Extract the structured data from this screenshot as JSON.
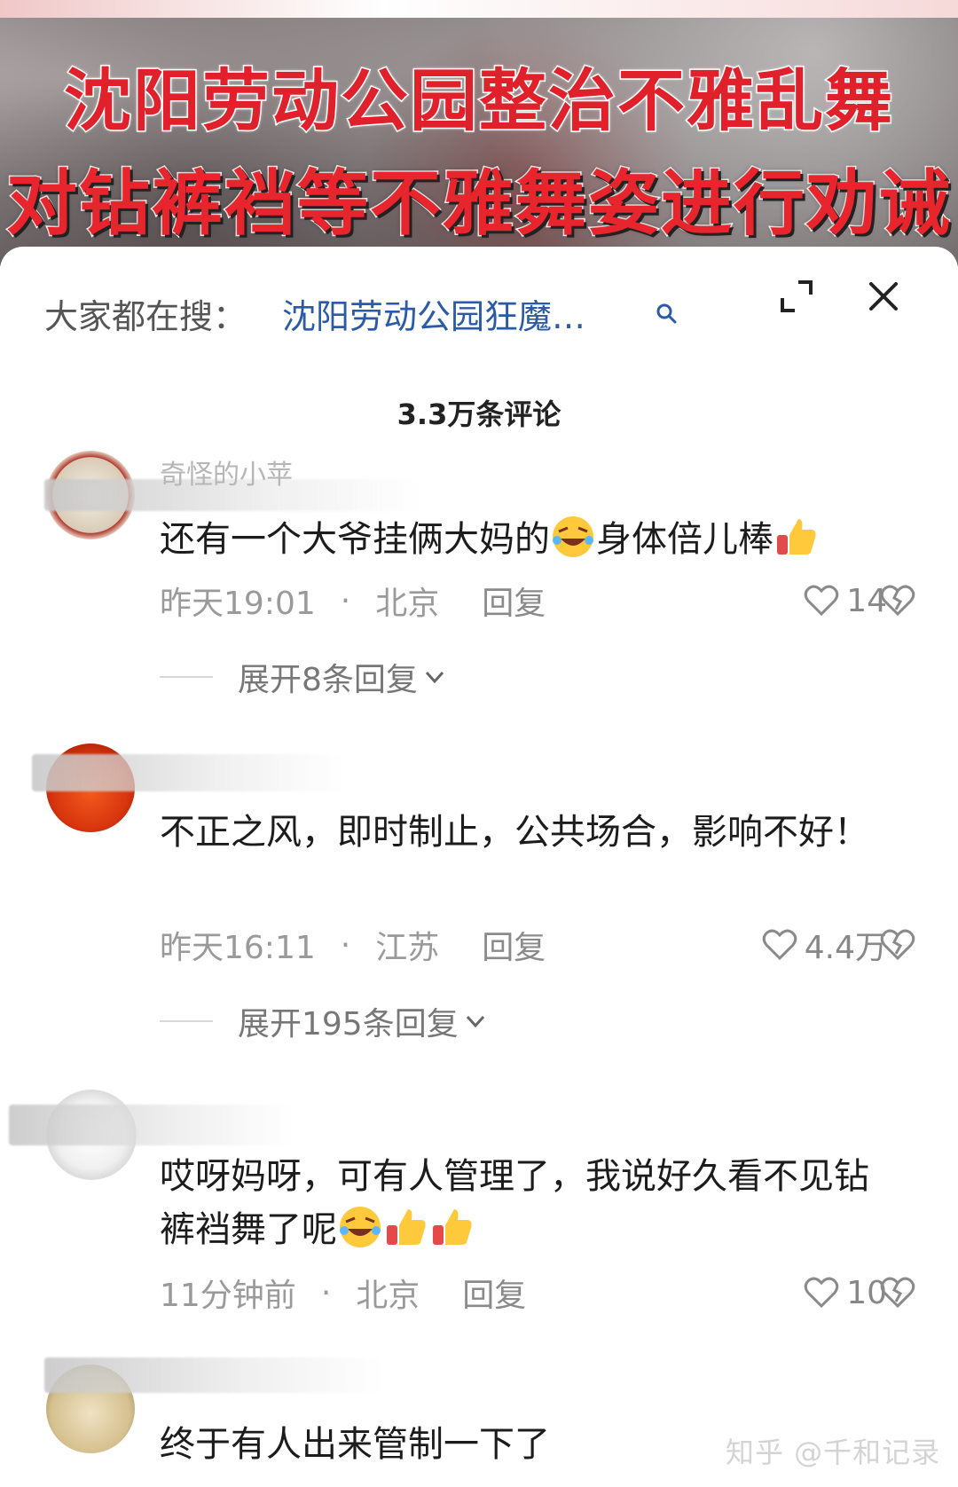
{
  "video": {
    "headline_line1": "沈阳劳动公园整治不雅乱舞",
    "headline_line2": "对钻裤裆等不雅舞姿进行劝诫"
  },
  "search": {
    "prefix": "大家都在搜：",
    "query": "沈阳劳动公园狂魔…",
    "search_icon": "search-icon"
  },
  "controls": {
    "expand_icon": "expand-icon",
    "close_icon": "close-icon"
  },
  "comment_count": "3.3万条评论",
  "comments": [
    {
      "username": "奇怪的小苹",
      "text_before": "还有一个大爷挂俩大妈的",
      "emoji_mid": "laughing-crying-emoji",
      "text_after": "身体倍儿棒",
      "emoji_end": "thumbs-up-emoji",
      "time": "昨天19:01",
      "location": "北京",
      "reply": "回复",
      "likes": "14",
      "expand": "展开8条回复"
    },
    {
      "username": "",
      "text": "不正之风，即时制止，公共场合，影响不好！",
      "time": "昨天16:11",
      "location": "江苏",
      "reply": "回复",
      "likes": "4.4万",
      "expand": "展开195条回复"
    },
    {
      "username": "",
      "text": "哎呀妈呀，可有人管理了，我说好久看不见钻裤裆舞了呢",
      "emojis": [
        "laughing-crying-emoji",
        "thumbs-up-emoji",
        "thumbs-up-emoji"
      ],
      "time": "11分钟前",
      "location": "北京",
      "reply": "回复",
      "likes": "10"
    },
    {
      "username": "",
      "text": "终于有人出来管制一下了"
    }
  ],
  "watermark": "知乎 @千和记录",
  "colors": {
    "headline_red": "#e0202a",
    "link_blue": "#2b5aa6",
    "meta_gray": "#9a9a9a"
  }
}
